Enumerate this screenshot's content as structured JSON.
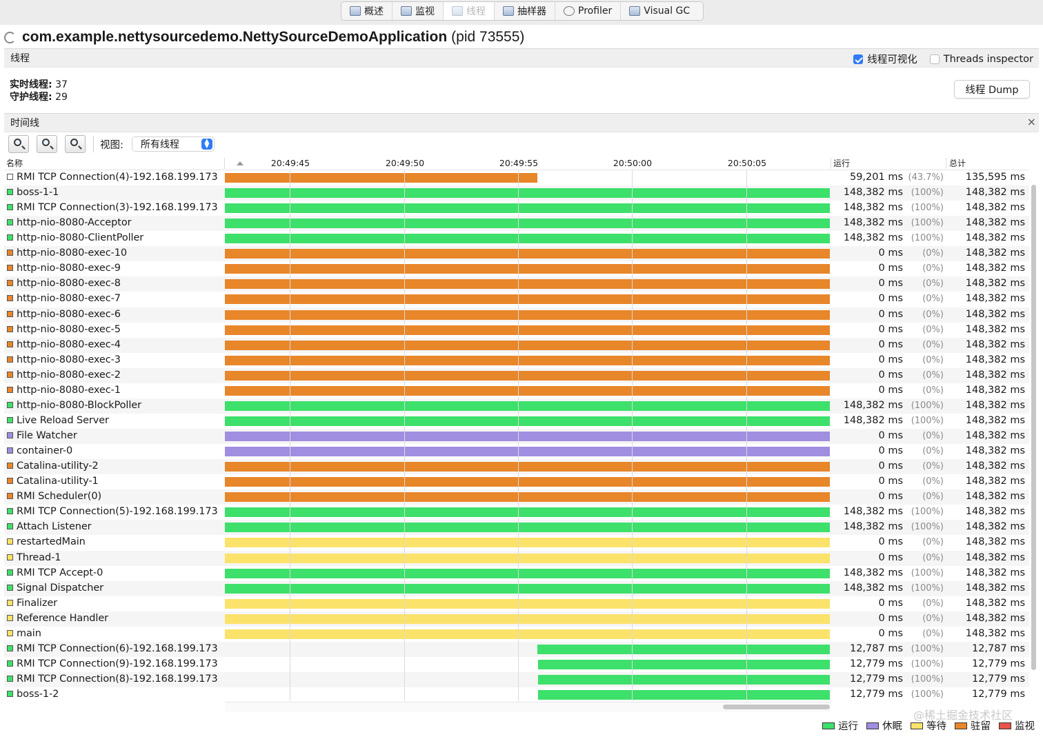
{
  "tabs": [
    {
      "label": "概述",
      "icon": "overview-icon",
      "active": false
    },
    {
      "label": "监视",
      "icon": "monitor-icon",
      "active": false
    },
    {
      "label": "线程",
      "icon": "threads-icon",
      "active": true
    },
    {
      "label": "抽样器",
      "icon": "sampler-icon",
      "active": false
    },
    {
      "label": "Profiler",
      "icon": "profiler-icon",
      "active": false
    },
    {
      "label": "Visual GC",
      "icon": "visual-gc-icon",
      "active": false
    }
  ],
  "app": {
    "name": "com.example.nettysourcedemo.NettySourceDemoApplication",
    "pid": "(pid 73555)"
  },
  "threads_section": {
    "label": "线程",
    "visualize_label": "线程可视化",
    "visualize_checked": true,
    "inspector_label": "Threads inspector",
    "inspector_checked": false,
    "live_label": "实时线程:",
    "live_value": "37",
    "daemon_label": "守护线程:",
    "daemon_value": "29",
    "dump_button": "线程 Dump"
  },
  "timeline": {
    "label": "时间线",
    "close": "×",
    "view_label": "视图:",
    "view_value": "所有线程",
    "zoom_in": "+",
    "zoom_out": "−",
    "zoom_fit": "1"
  },
  "table": {
    "col_name": "名称",
    "col_running": "运行",
    "col_total": "总计",
    "ticks": [
      "20:49:45",
      "20:49:50",
      "20:49:55",
      "20:50:00",
      "20:50:05"
    ]
  },
  "colors": {
    "running": "#3de06a",
    "sleeping": "#a08ee0",
    "wait": "#fbe26a",
    "park": "#e8862a",
    "monitor": "#e8534a",
    "finished": "#ffffff"
  },
  "threads": [
    {
      "name": "RMI TCP Connection(4)-192.168.199.173",
      "state": "finished",
      "bar_state": "park",
      "start": 0.0,
      "end": 0.517,
      "run": "59,201 ms",
      "pct": "(43.7%)",
      "total": "135,595 ms"
    },
    {
      "name": "boss-1-1",
      "state": "running",
      "bar_state": "running",
      "start": 0.0,
      "end": 1.0,
      "run": "148,382 ms",
      "pct": "(100%)",
      "total": "148,382 ms"
    },
    {
      "name": "RMI TCP Connection(3)-192.168.199.173",
      "state": "running",
      "bar_state": "running",
      "start": 0.0,
      "end": 1.0,
      "run": "148,382 ms",
      "pct": "(100%)",
      "total": "148,382 ms"
    },
    {
      "name": "http-nio-8080-Acceptor",
      "state": "running",
      "bar_state": "running",
      "start": 0.0,
      "end": 1.0,
      "run": "148,382 ms",
      "pct": "(100%)",
      "total": "148,382 ms"
    },
    {
      "name": "http-nio-8080-ClientPoller",
      "state": "running",
      "bar_state": "running",
      "start": 0.0,
      "end": 1.0,
      "run": "148,382 ms",
      "pct": "(100%)",
      "total": "148,382 ms"
    },
    {
      "name": "http-nio-8080-exec-10",
      "state": "park",
      "bar_state": "park",
      "start": 0.0,
      "end": 1.0,
      "run": "0 ms",
      "pct": "(0%)",
      "total": "148,382 ms"
    },
    {
      "name": "http-nio-8080-exec-9",
      "state": "park",
      "bar_state": "park",
      "start": 0.0,
      "end": 1.0,
      "run": "0 ms",
      "pct": "(0%)",
      "total": "148,382 ms"
    },
    {
      "name": "http-nio-8080-exec-8",
      "state": "park",
      "bar_state": "park",
      "start": 0.0,
      "end": 1.0,
      "run": "0 ms",
      "pct": "(0%)",
      "total": "148,382 ms"
    },
    {
      "name": "http-nio-8080-exec-7",
      "state": "park",
      "bar_state": "park",
      "start": 0.0,
      "end": 1.0,
      "run": "0 ms",
      "pct": "(0%)",
      "total": "148,382 ms"
    },
    {
      "name": "http-nio-8080-exec-6",
      "state": "park",
      "bar_state": "park",
      "start": 0.0,
      "end": 1.0,
      "run": "0 ms",
      "pct": "(0%)",
      "total": "148,382 ms"
    },
    {
      "name": "http-nio-8080-exec-5",
      "state": "park",
      "bar_state": "park",
      "start": 0.0,
      "end": 1.0,
      "run": "0 ms",
      "pct": "(0%)",
      "total": "148,382 ms"
    },
    {
      "name": "http-nio-8080-exec-4",
      "state": "park",
      "bar_state": "park",
      "start": 0.0,
      "end": 1.0,
      "run": "0 ms",
      "pct": "(0%)",
      "total": "148,382 ms"
    },
    {
      "name": "http-nio-8080-exec-3",
      "state": "park",
      "bar_state": "park",
      "start": 0.0,
      "end": 1.0,
      "run": "0 ms",
      "pct": "(0%)",
      "total": "148,382 ms"
    },
    {
      "name": "http-nio-8080-exec-2",
      "state": "park",
      "bar_state": "park",
      "start": 0.0,
      "end": 1.0,
      "run": "0 ms",
      "pct": "(0%)",
      "total": "148,382 ms"
    },
    {
      "name": "http-nio-8080-exec-1",
      "state": "park",
      "bar_state": "park",
      "start": 0.0,
      "end": 1.0,
      "run": "0 ms",
      "pct": "(0%)",
      "total": "148,382 ms"
    },
    {
      "name": "http-nio-8080-BlockPoller",
      "state": "running",
      "bar_state": "running",
      "start": 0.0,
      "end": 1.0,
      "run": "148,382 ms",
      "pct": "(100%)",
      "total": "148,382 ms"
    },
    {
      "name": "Live Reload Server",
      "state": "running",
      "bar_state": "running",
      "start": 0.0,
      "end": 1.0,
      "run": "148,382 ms",
      "pct": "(100%)",
      "total": "148,382 ms"
    },
    {
      "name": "File Watcher",
      "state": "sleeping",
      "bar_state": "sleeping",
      "start": 0.0,
      "end": 1.0,
      "run": "0 ms",
      "pct": "(0%)",
      "total": "148,382 ms"
    },
    {
      "name": "container-0",
      "state": "sleeping",
      "bar_state": "sleeping",
      "start": 0.0,
      "end": 1.0,
      "run": "0 ms",
      "pct": "(0%)",
      "total": "148,382 ms"
    },
    {
      "name": "Catalina-utility-2",
      "state": "park",
      "bar_state": "park",
      "start": 0.0,
      "end": 1.0,
      "run": "0 ms",
      "pct": "(0%)",
      "total": "148,382 ms"
    },
    {
      "name": "Catalina-utility-1",
      "state": "park",
      "bar_state": "park",
      "start": 0.0,
      "end": 1.0,
      "run": "0 ms",
      "pct": "(0%)",
      "total": "148,382 ms"
    },
    {
      "name": "RMI Scheduler(0)",
      "state": "park",
      "bar_state": "park",
      "start": 0.0,
      "end": 1.0,
      "run": "0 ms",
      "pct": "(0%)",
      "total": "148,382 ms"
    },
    {
      "name": "RMI TCP Connection(5)-192.168.199.173",
      "state": "running",
      "bar_state": "running",
      "start": 0.0,
      "end": 1.0,
      "run": "148,382 ms",
      "pct": "(100%)",
      "total": "148,382 ms"
    },
    {
      "name": "Attach Listener",
      "state": "running",
      "bar_state": "running",
      "start": 0.0,
      "end": 1.0,
      "run": "148,382 ms",
      "pct": "(100%)",
      "total": "148,382 ms"
    },
    {
      "name": "restartedMain",
      "state": "wait",
      "bar_state": "wait",
      "start": 0.0,
      "end": 1.0,
      "run": "0 ms",
      "pct": "(0%)",
      "total": "148,382 ms"
    },
    {
      "name": "Thread-1",
      "state": "wait",
      "bar_state": "wait",
      "start": 0.0,
      "end": 1.0,
      "run": "0 ms",
      "pct": "(0%)",
      "total": "148,382 ms"
    },
    {
      "name": "RMI TCP Accept-0",
      "state": "running",
      "bar_state": "running",
      "start": 0.0,
      "end": 1.0,
      "run": "148,382 ms",
      "pct": "(100%)",
      "total": "148,382 ms"
    },
    {
      "name": "Signal Dispatcher",
      "state": "running",
      "bar_state": "running",
      "start": 0.0,
      "end": 1.0,
      "run": "148,382 ms",
      "pct": "(100%)",
      "total": "148,382 ms"
    },
    {
      "name": "Finalizer",
      "state": "wait",
      "bar_state": "wait",
      "start": 0.0,
      "end": 1.0,
      "run": "0 ms",
      "pct": "(0%)",
      "total": "148,382 ms"
    },
    {
      "name": "Reference Handler",
      "state": "wait",
      "bar_state": "wait",
      "start": 0.0,
      "end": 1.0,
      "run": "0 ms",
      "pct": "(0%)",
      "total": "148,382 ms"
    },
    {
      "name": "main",
      "state": "wait",
      "bar_state": "wait",
      "start": 0.0,
      "end": 1.0,
      "run": "0 ms",
      "pct": "(0%)",
      "total": "148,382 ms"
    },
    {
      "name": "RMI TCP Connection(6)-192.168.199.173",
      "state": "running",
      "bar_state": "running",
      "start": 0.517,
      "end": 1.0,
      "run": "12,787 ms",
      "pct": "(100%)",
      "total": "12,787 ms"
    },
    {
      "name": "RMI TCP Connection(9)-192.168.199.173",
      "state": "running",
      "bar_state": "running",
      "start": 0.518,
      "end": 1.0,
      "run": "12,779 ms",
      "pct": "(100%)",
      "total": "12,779 ms"
    },
    {
      "name": "RMI TCP Connection(8)-192.168.199.173",
      "state": "running",
      "bar_state": "running",
      "start": 0.518,
      "end": 1.0,
      "run": "12,779 ms",
      "pct": "(100%)",
      "total": "12,779 ms"
    },
    {
      "name": "boss-1-2",
      "state": "running",
      "bar_state": "running",
      "start": 0.518,
      "end": 1.0,
      "run": "12,779 ms",
      "pct": "(100%)",
      "total": "12,779 ms"
    }
  ],
  "legend": [
    {
      "label": "运行",
      "state": "running"
    },
    {
      "label": "休眠",
      "state": "sleeping"
    },
    {
      "label": "等待",
      "state": "wait"
    },
    {
      "label": "驻留",
      "state": "park"
    },
    {
      "label": "监视",
      "state": "monitor"
    }
  ],
  "watermark": "@稀土掘金技术社区"
}
